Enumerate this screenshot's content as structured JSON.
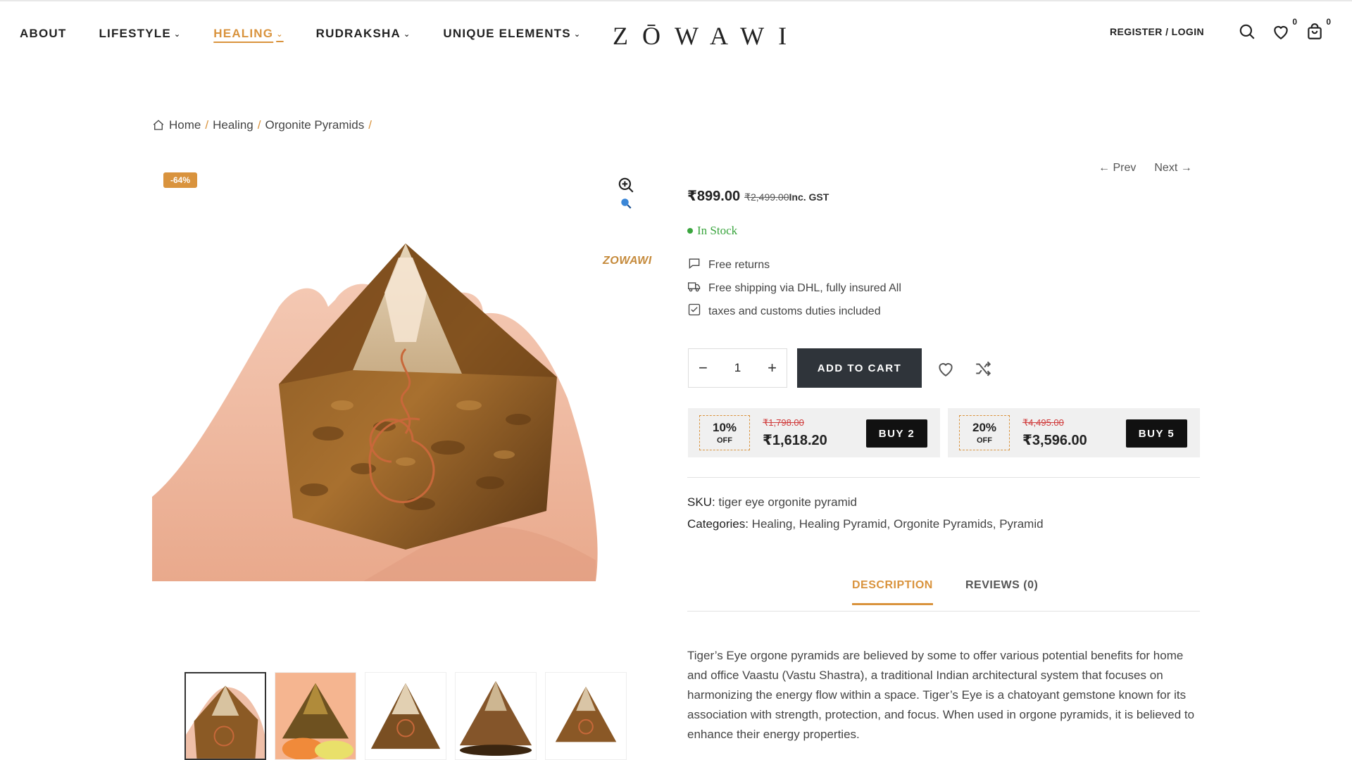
{
  "nav": {
    "items": [
      {
        "label": "ABOUT",
        "dropdown": false
      },
      {
        "label": "LIFESTYLE",
        "dropdown": true
      },
      {
        "label": "HEALING",
        "dropdown": true,
        "active": true
      },
      {
        "label": "RUDRAKSHA",
        "dropdown": true
      },
      {
        "label": "UNIQUE ELEMENTS",
        "dropdown": true
      }
    ],
    "logo": "ZŌWAWI",
    "register_login": "REGISTER / LOGIN",
    "wishlist_count": "0",
    "cart_count": "0"
  },
  "breadcrumb": {
    "home": "Home",
    "level1": "Healing",
    "level2": "Orgonite Pyramids",
    "sep": "/"
  },
  "gallery": {
    "badge": "-64%",
    "watermark": "ZOWAWI",
    "thumbnail_count": 5
  },
  "product": {
    "prev": "Prev",
    "next": "Next",
    "price": "₹899.00",
    "old_price": "₹2,499.00",
    "tax_note": "Inc. GST",
    "stock": "In Stock",
    "features": [
      {
        "icon": "chat-bubble-icon",
        "text": "Free returns"
      },
      {
        "icon": "truck-icon",
        "text": "Free shipping via DHL, fully insured All"
      },
      {
        "icon": "checkbox-icon",
        "text": "taxes and customs duties included"
      }
    ],
    "quantity": "1",
    "add_to_cart": "ADD TO CART",
    "bundles": [
      {
        "discount": "10%",
        "off": "OFF",
        "was": "₹1,798.00",
        "now": "₹1,618.20",
        "button": "BUY 2"
      },
      {
        "discount": "20%",
        "off": "OFF",
        "was": "₹4,495.00",
        "now": "₹3,596.00",
        "button": "BUY 5"
      }
    ],
    "sku_label": "SKU:",
    "sku": "tiger eye orgonite pyramid",
    "categories_label": "Categories:",
    "categories": [
      "Healing",
      "Healing Pyramid",
      "Orgonite Pyramids",
      "Pyramid"
    ]
  },
  "tabs": [
    {
      "label": "DESCRIPTION",
      "active": true
    },
    {
      "label": "REVIEWS (0)",
      "active": false
    }
  ],
  "description": "Tiger’s Eye orgone pyramids are believed by some to offer various potential benefits for home and office Vaastu (Vastu Shastra), a traditional Indian architectural system that focuses on harmonizing the energy flow within a space. Tiger’s Eye is a chatoyant gemstone known for its association with strength, protection, and focus. When used in orgone pyramids, it is believed to enhance their energy properties.",
  "colors": {
    "accent": "#d9933d",
    "button_dark": "#2f343a",
    "stock_green": "#3aa53e",
    "strike_red": "#d03b3b"
  }
}
